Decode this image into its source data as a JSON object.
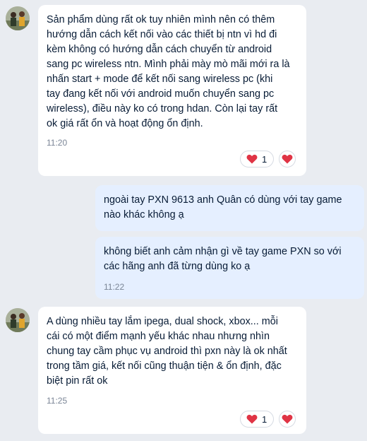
{
  "conversation": {
    "messages": [
      {
        "sender": "contact",
        "text": "Sản phẩm dùng rất ok tuy nhiên mình nên có thêm\nhướng dẫn cách kết nối  vào các thiết bị ntn vì hd đi\nkèm không có hướng dẫn cách chuyển từ android\nsang pc wireless ntn. Mình phải mày mò mãi mới ra là\nnhấn start + mode để kết nối sang wireless pc (khi\ntay đang kết nối với android muốn chuyển sang pc\nwireless), điều này ko có trong hdan. Còn lại tay rất\nok giá rất ổn và hoạt động ổn định.",
        "time": "11:20",
        "reaction_count": "1"
      },
      {
        "sender": "me",
        "text": "ngoài tay PXN 9613 anh Quân có dùng với tay game\nnào khác không ạ"
      },
      {
        "sender": "me",
        "text": "không biết anh cảm nhận gì về tay game PXN so với\ncác hãng anh đã từng dùng ko ạ",
        "time": "11:22"
      },
      {
        "sender": "contact",
        "text": "A dùng nhiều tay lắm ipega, dual shock, xbox... mỗi\ncái có một điểm mạnh yếu khác nhau nhưng nhìn\nchung tay cầm phục vụ android thì pxn này là ok nhất\ntrong tầm giá, kết nối cũng thuận tiện & ổn định, đặc\nbiệt pin rất ok",
        "time": "11:25",
        "reaction_count": "1"
      }
    ]
  },
  "colors": {
    "background": "#e9ecf1",
    "incoming_bubble": "#ffffff",
    "outgoing_bubble": "#e5efff",
    "heart": "#e03445",
    "text": "#081c36",
    "time": "#7a8596"
  },
  "icons": {
    "avatar": "avatar-photo",
    "reaction": "heart-icon",
    "react_button": "heart-icon"
  }
}
